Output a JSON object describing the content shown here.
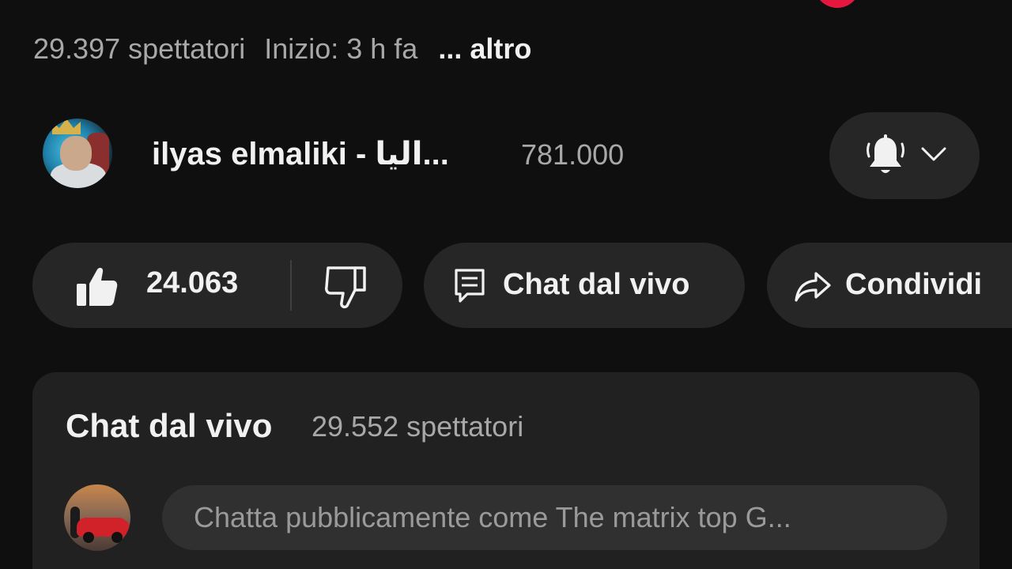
{
  "video": {
    "title_fragment": "",
    "viewers": "29.397 spettatori",
    "started": "Inizio: 3 h fa",
    "more_label": "... altro"
  },
  "channel": {
    "name": "ilyas elmaliki - اليا...",
    "subscribers": "781.000",
    "avatar_icon": "channel-avatar",
    "notification_icon": "bell-icon",
    "dropdown_icon": "chevron-down-icon"
  },
  "actions": {
    "like_count": "24.063",
    "like_icon": "thumbs-up-icon",
    "dislike_icon": "thumbs-down-icon",
    "chat_label": "Chat dal vivo",
    "chat_icon": "chat-icon",
    "share_label": "Condividi",
    "share_icon": "share-icon"
  },
  "live_chat": {
    "heading": "Chat dal vivo",
    "viewers": "29.552 spettatori",
    "input_placeholder": "Chatta pubblicamente come The matrix top G..."
  },
  "colors": {
    "background": "#0f0f0f",
    "pill": "#262626",
    "panel": "#212121",
    "input": "#303030",
    "live_red": "#e5173f",
    "secondary_text": "#a8a8a8"
  }
}
